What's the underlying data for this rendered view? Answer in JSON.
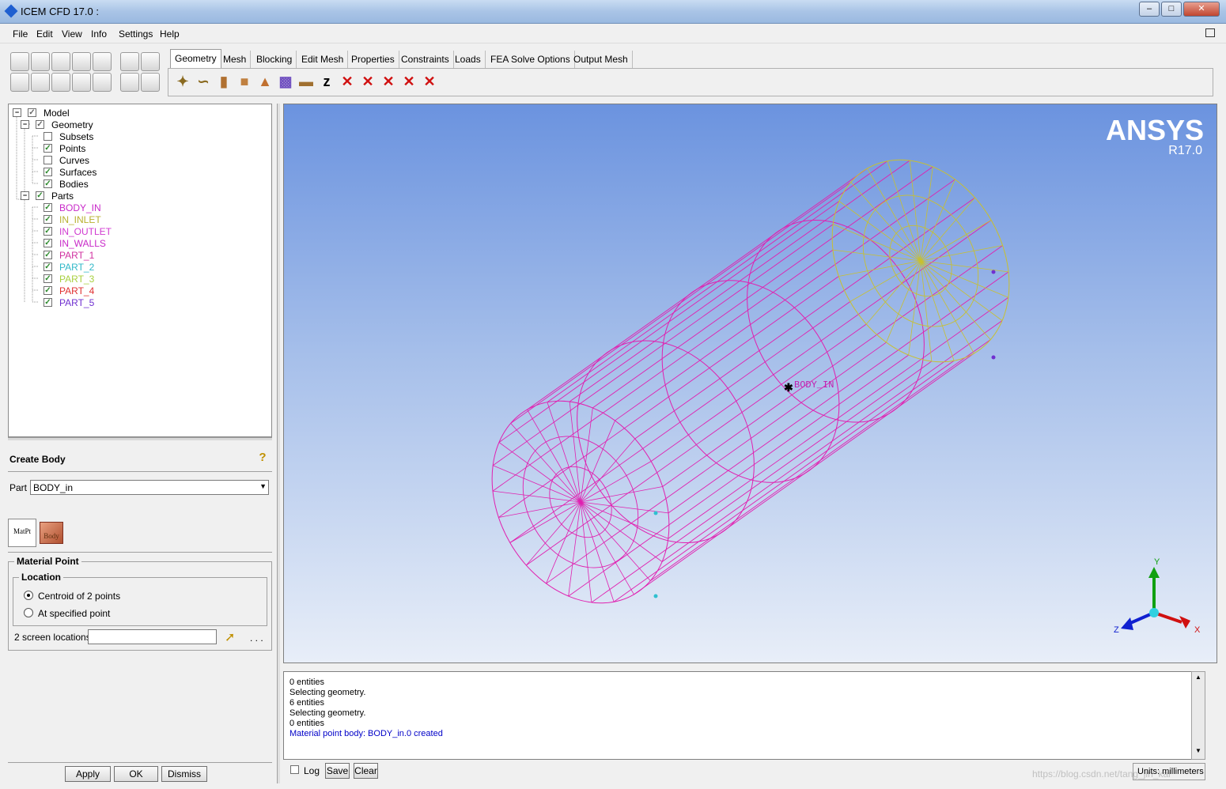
{
  "window": {
    "title": "ICEM CFD 17.0 :"
  },
  "menu": [
    "File",
    "Edit",
    "View",
    "Info",
    "Settings",
    "Help"
  ],
  "tabs": [
    "Geometry",
    "Mesh",
    "Blocking",
    "Edit Mesh",
    "Properties",
    "Constraints",
    "Loads",
    "FEA Solve Options",
    "Output Mesh"
  ],
  "tree": {
    "model": "Model",
    "geometry": "Geometry",
    "geometry_items": [
      {
        "label": "Subsets",
        "checked": false
      },
      {
        "label": "Points",
        "checked": true
      },
      {
        "label": "Curves",
        "checked": false
      },
      {
        "label": "Surfaces",
        "checked": true
      },
      {
        "label": "Bodies",
        "checked": true
      }
    ],
    "parts": "Parts",
    "part_items": [
      {
        "label": "BODY_IN",
        "color": "#c828c8"
      },
      {
        "label": "IN_INLET",
        "color": "#b8b030"
      },
      {
        "label": "IN_OUTLET",
        "color": "#d03ad0"
      },
      {
        "label": "IN_WALLS",
        "color": "#c828c8"
      },
      {
        "label": "PART_1",
        "color": "#d030a0"
      },
      {
        "label": "PART_2",
        "color": "#30b8c8"
      },
      {
        "label": "PART_3",
        "color": "#a8d040"
      },
      {
        "label": "PART_4",
        "color": "#e03030"
      },
      {
        "label": "PART_5",
        "color": "#7030d0"
      }
    ]
  },
  "panel": {
    "title": "Create Body",
    "part_label": "Part",
    "part_value": "BODY_in",
    "icon_matpt": "MatPt",
    "icon_body": "Body",
    "material_point": "Material Point",
    "location": "Location",
    "opt1": "Centroid of 2 points",
    "opt2": "At specified point",
    "screen_locations": "2 screen locations",
    "ellipsis": ". . .",
    "apply": "Apply",
    "ok": "OK",
    "dismiss": "Dismiss"
  },
  "viewport": {
    "brand": "ANSYS",
    "version": "R17.0",
    "body_label": "BODY_IN",
    "axis_x": "X",
    "axis_y": "Y",
    "axis_z": "Z"
  },
  "messages": [
    {
      "text": "0 entities",
      "color": "#000000"
    },
    {
      "text": "Selecting geometry.",
      "color": "#000000"
    },
    {
      "text": "6 entities",
      "color": "#000000"
    },
    {
      "text": "Selecting geometry.",
      "color": "#000000"
    },
    {
      "text": "0 entities",
      "color": "#000000"
    },
    {
      "text": "Material point body: BODY_in.0 created",
      "color": "#0000c8"
    }
  ],
  "bottom": {
    "log": "Log",
    "save": "Save",
    "clear": "Clear",
    "units": "Units: millimeters",
    "watermark": "https://blog.csdn.net/tang_jin_kai"
  },
  "colors": {
    "wire": "#e020b0",
    "inlet": "#c8c030"
  }
}
